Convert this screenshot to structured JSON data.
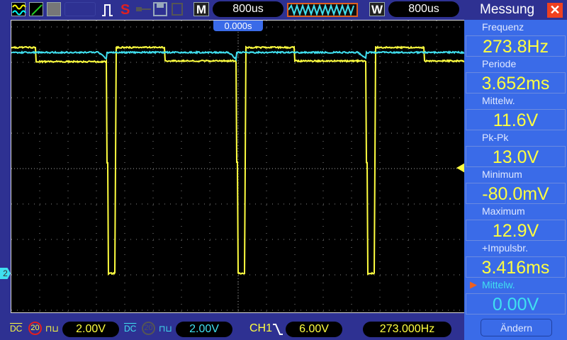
{
  "toolbar": {
    "timebase_mode": "M",
    "timebase": "800us",
    "window_mode": "W",
    "window_timebase": "800us",
    "run_state": "S",
    "trigger_time": "0.000s",
    "icons": [
      "channels-icon",
      "xy-icon",
      "persistence-icon",
      "pulse-icon",
      "lock-icon",
      "save-icon",
      "print-icon"
    ]
  },
  "bottom": {
    "ch1": {
      "coupling": "DC",
      "bw_limit": "20",
      "scale": "2.00V",
      "color": "#ffff40"
    },
    "ch2": {
      "coupling": "DC",
      "bw_limit": "20",
      "scale": "2.00V",
      "color": "#40e0f0"
    },
    "trigger": {
      "source": "CH1",
      "slope": "falling",
      "level": "6.00V"
    },
    "frequency": "273.000Hz"
  },
  "marker": {
    "ch2": "2"
  },
  "panel": {
    "title": "Messung",
    "change_button": "Ändern",
    "items": [
      {
        "label": "Frequenz",
        "value": "273.8Hz"
      },
      {
        "label": "Periode",
        "value": "3.652ms"
      },
      {
        "label": "Mittelw.",
        "value": "11.6V"
      },
      {
        "label": "Pk-Pk",
        "value": "13.0V"
      },
      {
        "label": "Minimum",
        "value": "-80.0mV"
      },
      {
        "label": "Maximum",
        "value": "12.9V"
      },
      {
        "label": "+Impulsbr.",
        "value": "3.416ms"
      },
      {
        "label": "Mittelw.",
        "value": "0.00V"
      }
    ]
  },
  "colors": {
    "ch1": "#ffff40",
    "ch2": "#40e0f0",
    "background": "#2e3192",
    "panel": "#3a6be8"
  }
}
